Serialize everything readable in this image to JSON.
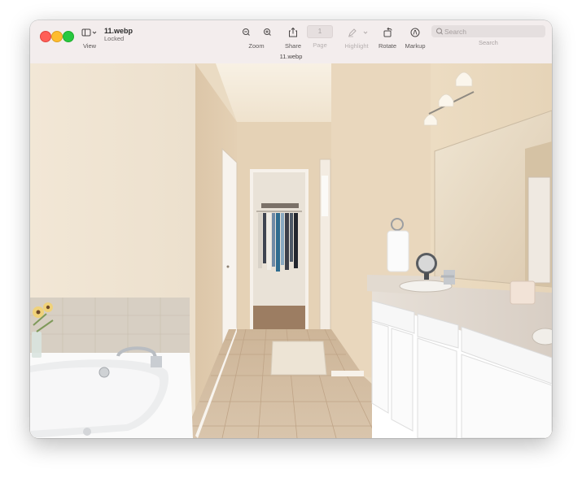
{
  "window": {
    "file_name": "11.webp",
    "file_status": "Locked",
    "document_label": "11.webp"
  },
  "toolbar": {
    "view_label": "View",
    "zoom_label": "Zoom",
    "share_label": "Share",
    "page_label": "Page",
    "page_value": "1",
    "highlight_label": "Highlight",
    "rotate_label": "Rotate",
    "markup_label": "Markup",
    "search_label": "Search",
    "search_placeholder": "Search"
  },
  "icons": {
    "close": "close-button",
    "minimize": "minimize-button",
    "zoom_window": "zoom-window-button",
    "sidebar": "sidebar-icon",
    "zoom_out": "zoom-out-icon",
    "zoom_in": "zoom-in-icon",
    "share": "share-icon",
    "highlight": "pencil-icon",
    "rotate": "rotate-icon",
    "markup": "markup-icon",
    "search": "search-icon"
  },
  "colors": {
    "close": "#ff5f57",
    "minimize": "#febc2e",
    "zoom": "#28c840",
    "titlebar": "#f3eded",
    "wall": "#efe1c8",
    "tile": "#d8c2a6",
    "vanity": "#ffffff"
  }
}
